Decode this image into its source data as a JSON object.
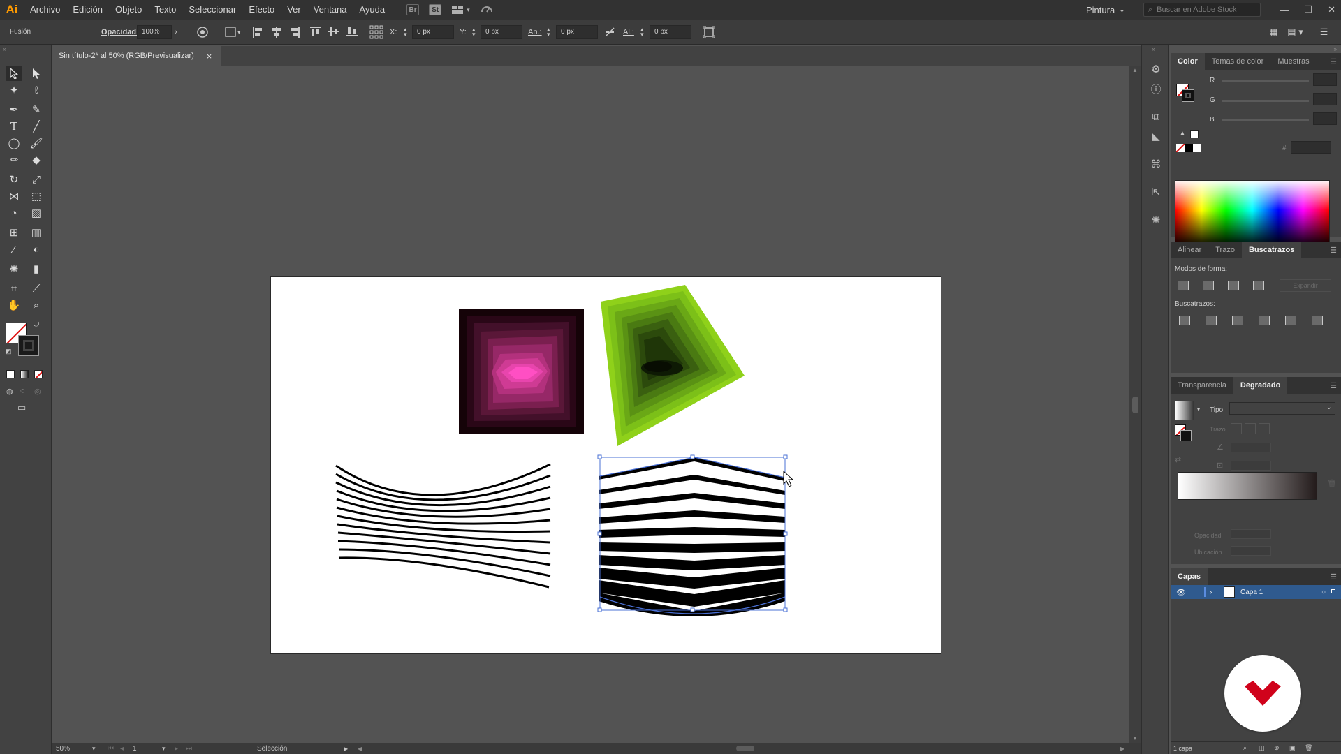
{
  "app": {
    "logo": "Ai",
    "menu": [
      "Archivo",
      "Edición",
      "Objeto",
      "Texto",
      "Seleccionar",
      "Efecto",
      "Ver",
      "Ventana",
      "Ayuda"
    ],
    "bridge_icon": "Br",
    "stock_icon": "St",
    "workspace": "Pintura",
    "stock_search_placeholder": "Buscar en Adobe Stock"
  },
  "control_bar": {
    "selection_label": "Fusión",
    "opacity_label": "Opacidad:",
    "opacity_value": "100%",
    "x_label": "X:",
    "x_value": "0 px",
    "y_label": "Y:",
    "y_value": "0 px",
    "width_label": "An.:",
    "width_value": "0 px",
    "height_label": "Al.:",
    "height_value": "0 px"
  },
  "document": {
    "tab_title": "Sin título-2* al 50% (RGB/Previsualizar)",
    "close_glyph": "×"
  },
  "status_bar": {
    "zoom": "50%",
    "artboard_index": "1",
    "tool_name": "Selección"
  },
  "color_panel": {
    "tabs": [
      "Color",
      "Temas de color",
      "Muestras"
    ],
    "channels": [
      "R",
      "G",
      "B"
    ],
    "hex_label": "#"
  },
  "pathfinder_panel": {
    "tabs": [
      "Alinear",
      "Trazo",
      "Buscatrazos"
    ],
    "shape_modes_label": "Modos de forma:",
    "expand_label": "Expandir",
    "pathfinders_label": "Buscatrazos:"
  },
  "gradient_panel": {
    "tabs": [
      "Transparencia",
      "Degradado"
    ],
    "type_label": "Tipo:",
    "stroke_label": "Trazo",
    "opacity_label": "Opacidad",
    "location_label": "Ubicación"
  },
  "layers_panel": {
    "tab": "Capas",
    "layer_name": "Capa 1",
    "count": "1 capa"
  },
  "colors": {
    "accent_orange": "#ff9a00",
    "selection_blue": "#2f5a8e",
    "brand_red": "#d0021b"
  }
}
